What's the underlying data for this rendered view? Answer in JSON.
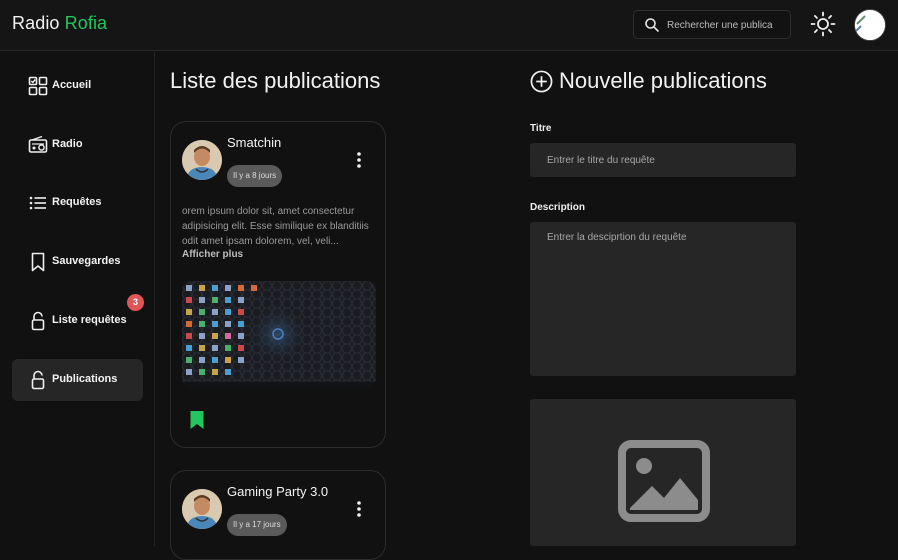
{
  "header": {
    "brand_main": "Radio",
    "brand_accent": "Rofia",
    "search_placeholder": "Rechercher une publica",
    "accent_color": "#22c55e"
  },
  "sidebar": {
    "items": [
      {
        "label": "Accueil",
        "icon": "dashboard-icon"
      },
      {
        "label": "Radio",
        "icon": "radio-icon"
      },
      {
        "label": "Requêtes",
        "icon": "list-icon"
      },
      {
        "label": "Sauvegardes",
        "icon": "bookmark-icon"
      },
      {
        "label": "Liste requêtes",
        "icon": "lock-icon",
        "badge": "3"
      },
      {
        "label": "Publications",
        "icon": "lock-icon",
        "active": true
      }
    ]
  },
  "publications": {
    "title": "Liste des publications",
    "cards": [
      {
        "title": "Smatchin",
        "time": "Il y a 8 jours",
        "description": "orem ipsum dolor sit, amet consectetur adipisicing elit. Esse similique ex blanditiis odit amet ipsam dolorem, vel, veli...",
        "more_label": "Afficher plus"
      },
      {
        "title": "Gaming Party 3.0",
        "time": "Il y a 17 jours"
      }
    ]
  },
  "form": {
    "title": "Nouvelle publications",
    "title_label": "Titre",
    "title_placeholder": "Entrer le titre du requête",
    "description_label": "Description",
    "description_placeholder": "Entrer la desciprtion du requête"
  }
}
